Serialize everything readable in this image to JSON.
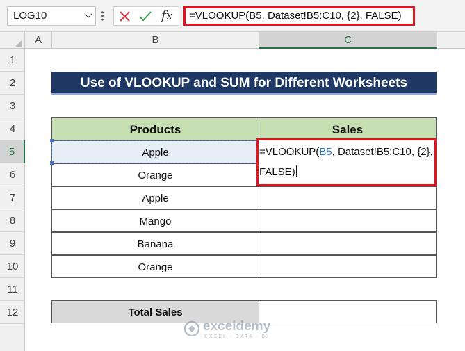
{
  "formula_bar": {
    "name_box": "LOG10",
    "formula": "=VLOOKUP(B5, Dataset!B5:C10, {2}, FALSE)",
    "fx_label": "fx",
    "icons": [
      "cancel-icon",
      "enter-check-icon",
      "insert-function-icon"
    ]
  },
  "columns": [
    "A",
    "B",
    "C"
  ],
  "selected_column": "C",
  "rows": [
    "1",
    "2",
    "3",
    "4",
    "5",
    "6",
    "7",
    "8",
    "9",
    "10",
    "11",
    "12"
  ],
  "selected_row": "5",
  "sheet": {
    "title": "Use of VLOOKUP and SUM for Different Worksheets",
    "headers": {
      "products": "Products",
      "sales": "Sales"
    },
    "products": [
      "Apple",
      "Orange",
      "Apple",
      "Mango",
      "Banana",
      "Orange"
    ],
    "total_label": "Total Sales",
    "editing": {
      "prefix": "=VLOOKUP(",
      "ref": "B5",
      "rest": ", Dataset!B5:C10, {2}, FALSE)"
    }
  },
  "watermark": {
    "name": "exceldemy",
    "tagline": "EXCEL · DATA · BI"
  },
  "colors": {
    "title_bg": "#1f3864",
    "header_bg": "#c6e0b4",
    "highlight_border": "#e0141e",
    "ref_blue": "#2e75b6",
    "excel_green": "#217346"
  }
}
